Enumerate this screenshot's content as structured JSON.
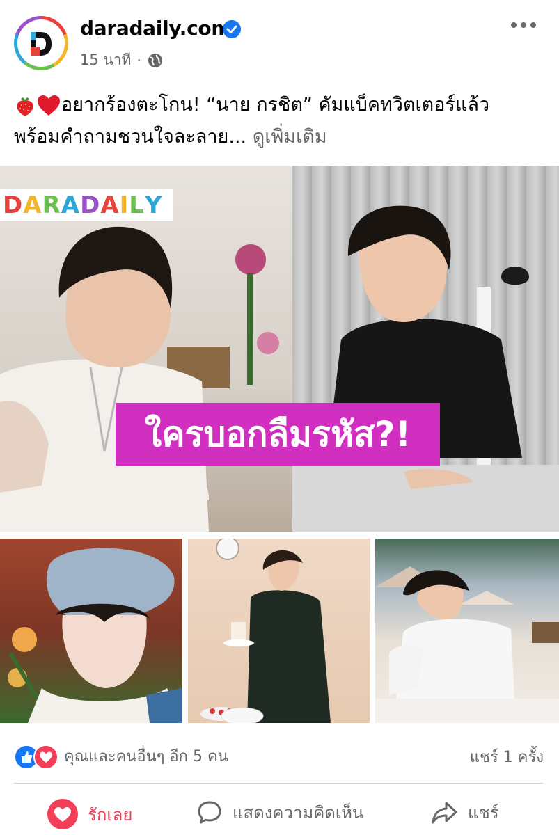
{
  "header": {
    "page_name": "daradaily.com",
    "time": "15 นาที",
    "separator": "·",
    "icons": [
      "logo-d-icon",
      "verified-badge-icon",
      "globe-icon",
      "more-dots-icon"
    ]
  },
  "post": {
    "text_line1": "อยากร้องตะโกน! “นาย กรชิต” คัมแบ็คทวิตเตอร์แล้ว",
    "text_line2": "พร้อมคำถามชวนใจละลาย...",
    "see_more": "ดูเพิ่มเติม",
    "emojis": [
      "strawberry-emoji",
      "red-heart-emoji"
    ]
  },
  "media": {
    "watermark": [
      "D",
      "A",
      "R",
      "A",
      "D",
      "A",
      "I",
      "L",
      "Y"
    ],
    "headline": "ใครบอกลืมรหัส?!"
  },
  "reactions": {
    "summary": "คุณและคนอื่นๆ อีก 5 คน",
    "shares": "แชร์ 1 ครั้ง"
  },
  "actions": {
    "love_label": "รักเลย",
    "comment_label": "แสดงความคิดเห็น",
    "share_label": "แชร์"
  },
  "colors": {
    "brand_blue": "#1877f2",
    "love_red": "#f33e58",
    "headline_magenta": "#d12fc0",
    "muted_text": "#65676b"
  }
}
